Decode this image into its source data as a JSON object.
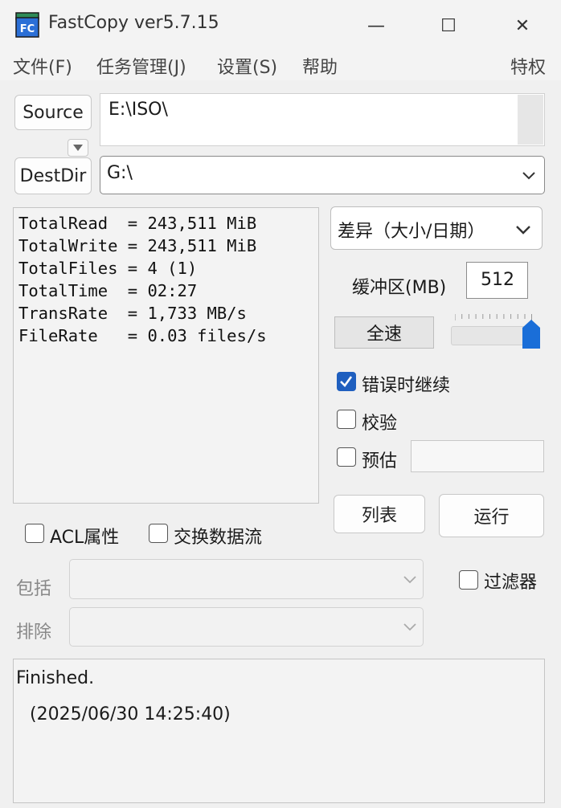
{
  "window": {
    "title": "FastCopy ver5.7.15",
    "icon_text": "FC",
    "controls": {
      "minimize": "—",
      "maximize": "☐",
      "close": "✕"
    }
  },
  "menu": {
    "file": "文件(F)",
    "task": "任务管理(J)",
    "settings": "设置(S)",
    "help": "帮助",
    "privilege": "特权"
  },
  "source": {
    "button_label": "Source",
    "path": "E:\\ISO\\"
  },
  "dest": {
    "button_label": "DestDir",
    "path": "G:\\"
  },
  "stats": [
    "TotalRead  = 243,511 MiB",
    "TotalWrite = 243,511 MiB",
    "TotalFiles = 4 (1)",
    "TotalTime  = 02:27",
    "TransRate  = 1,733 MB/s",
    "FileRate   = 0.03 files/s"
  ],
  "mode": {
    "selected": "差异（大小/日期）"
  },
  "buffer": {
    "label": "缓冲区(MB)",
    "value": "512"
  },
  "speed": {
    "button_label": "全速",
    "slider_level": 1.0
  },
  "options": {
    "continue_on_error": {
      "label": "错误时继续",
      "checked": true
    },
    "verify": {
      "label": "校验",
      "checked": false
    },
    "estimate": {
      "label": "预估",
      "checked": false
    },
    "acl": {
      "label": "ACL属性",
      "checked": false
    },
    "alt_stream": {
      "label": "交换数据流",
      "checked": false
    },
    "filter": {
      "label": "过滤器",
      "checked": false
    }
  },
  "actions": {
    "list": "列表",
    "execute": "运行"
  },
  "filters": {
    "include_label": "包括",
    "exclude_label": "排除"
  },
  "status": {
    "line1": "Finished.",
    "line2": "(2025/06/30 14:25:40)"
  },
  "colors": {
    "accent": "#1f5fbf",
    "background": "#f0f0f0"
  }
}
